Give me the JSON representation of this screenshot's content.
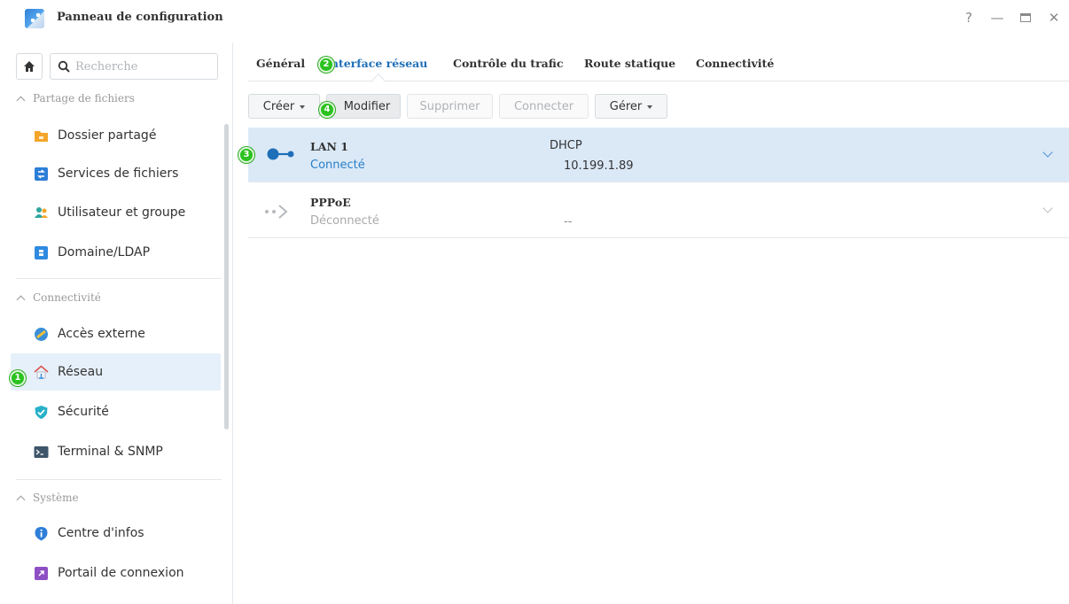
{
  "window": {
    "title": "Panneau de configuration",
    "help_glyph": "?",
    "minimize_glyph": "—",
    "close_glyph": "✕"
  },
  "sidebar": {
    "search_placeholder": "Recherche",
    "sections": {
      "file_sharing": "Partage de fichiers",
      "connectivity": "Connectivité",
      "system": "Système"
    },
    "items": [
      {
        "label": "Dossier partagé",
        "icon": "folder-icon"
      },
      {
        "label": "Services de fichiers",
        "icon": "file-services-icon"
      },
      {
        "label": "Utilisateur et groupe",
        "icon": "users-icon"
      },
      {
        "label": "Domaine/LDAP",
        "icon": "directory-icon"
      },
      {
        "label": "Accès externe",
        "icon": "external-access-icon"
      },
      {
        "label": "Réseau",
        "icon": "network-house-icon",
        "active": true
      },
      {
        "label": "Sécurité",
        "icon": "shield-check-icon"
      },
      {
        "label": "Terminal & SNMP",
        "icon": "terminal-icon"
      },
      {
        "label": "Centre d'infos",
        "icon": "info-icon"
      },
      {
        "label": "Portail de connexion",
        "icon": "portal-icon"
      }
    ]
  },
  "tabs": [
    {
      "label": "Général"
    },
    {
      "label": "Interface réseau",
      "active": true
    },
    {
      "label": "Contrôle du trafic"
    },
    {
      "label": "Route statique"
    },
    {
      "label": "Connectivité"
    }
  ],
  "toolbar": {
    "create": "Créer",
    "modify": "Modifier",
    "delete": "Supprimer",
    "connect": "Connecter",
    "manage": "Gérer"
  },
  "interfaces": [
    {
      "name": "LAN 1",
      "status": "Connecté",
      "mode": "DHCP",
      "address": "10.199.1.89",
      "status_color": "#2a7fc8"
    },
    {
      "name": "PPPoE",
      "status": "Déconnecté",
      "mode": "",
      "address": "--",
      "status_color": "#aaaaaa"
    }
  ],
  "markers": [
    "1",
    "2",
    "3",
    "4"
  ],
  "colors": {
    "accent": "#1f6fb8",
    "selected_row": "#dbe9f7",
    "marker": "#2bc21f"
  }
}
